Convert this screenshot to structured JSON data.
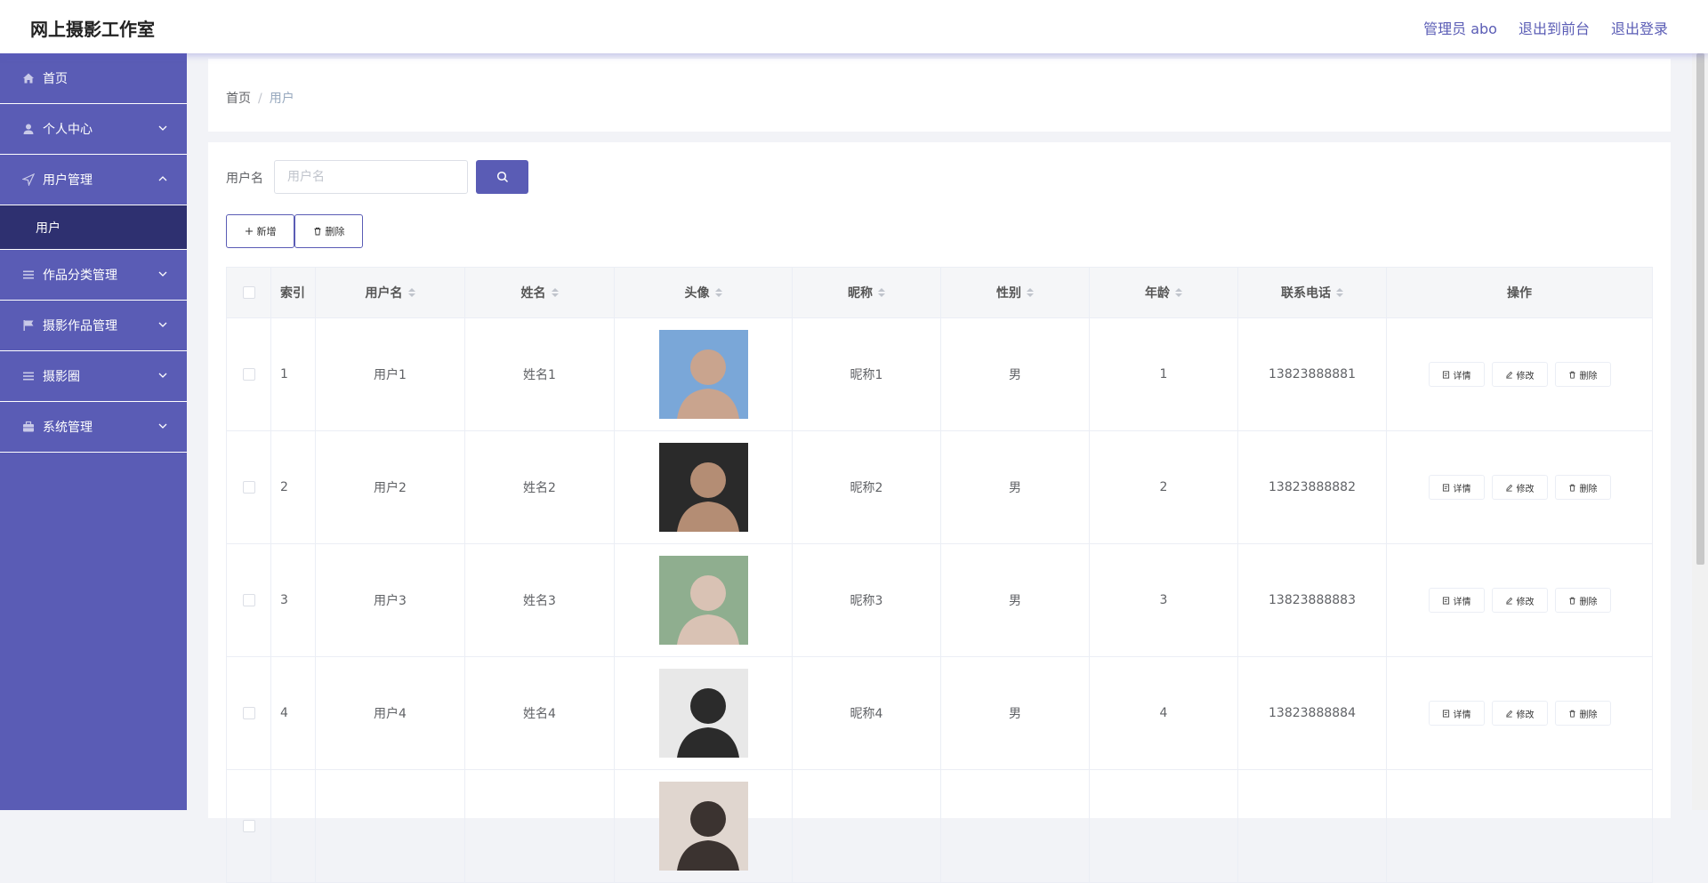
{
  "header": {
    "brand": "网上摄影工作室",
    "admin": "管理员 abo",
    "front": "退出到前台",
    "logout": "退出登录"
  },
  "sidebar": {
    "items": [
      {
        "label": "首页",
        "icon": "home-icon"
      },
      {
        "label": "个人中心",
        "icon": "user-icon"
      },
      {
        "label": "用户管理",
        "icon": "navigation-icon"
      },
      {
        "label": "作品分类管理",
        "icon": "list-icon"
      },
      {
        "label": "摄影作品管理",
        "icon": "flag-icon"
      },
      {
        "label": "摄影圈",
        "icon": "list-icon"
      },
      {
        "label": "系统管理",
        "icon": "briefcase-icon"
      }
    ],
    "submenu": "用户"
  },
  "breadcrumb": {
    "home": "首页",
    "sep": "/",
    "current": "用户"
  },
  "search": {
    "label": "用户名",
    "placeholder": "用户名"
  },
  "actions": {
    "add": "新增",
    "delete": "删除"
  },
  "table": {
    "headers": [
      "索引",
      "用户名",
      "姓名",
      "头像",
      "昵称",
      "性别",
      "年龄",
      "联系电话",
      "操作"
    ],
    "ops": {
      "detail": "详情",
      "edit": "修改",
      "delete": "删除"
    },
    "rows": [
      {
        "index": "1",
        "username": "用户1",
        "name": "姓名1",
        "nickname": "昵称1",
        "gender": "男",
        "age": "1",
        "phone": "13823888881",
        "avatar_colors": [
          "#7aa7d8",
          "#c9a48e"
        ]
      },
      {
        "index": "2",
        "username": "用户2",
        "name": "姓名2",
        "nickname": "昵称2",
        "gender": "男",
        "age": "2",
        "phone": "13823888882",
        "avatar_colors": [
          "#2a2a2a",
          "#b48d74"
        ]
      },
      {
        "index": "3",
        "username": "用户3",
        "name": "姓名3",
        "nickname": "昵称3",
        "gender": "男",
        "age": "3",
        "phone": "13823888883",
        "avatar_colors": [
          "#8fae8f",
          "#d9c2b4"
        ]
      },
      {
        "index": "4",
        "username": "用户4",
        "name": "姓名4",
        "nickname": "昵称4",
        "gender": "男",
        "age": "4",
        "phone": "13823888884",
        "avatar_colors": [
          "#e8e8e8",
          "#2b2b2b"
        ]
      },
      {
        "index": "",
        "username": "",
        "name": "",
        "nickname": "",
        "gender": "",
        "age": "",
        "phone": "",
        "avatar_colors": [
          "#e0d6cf",
          "#3b3330"
        ]
      }
    ]
  },
  "colors": {
    "accent": "#5a5cb5",
    "submenu_active": "#2e3070"
  }
}
